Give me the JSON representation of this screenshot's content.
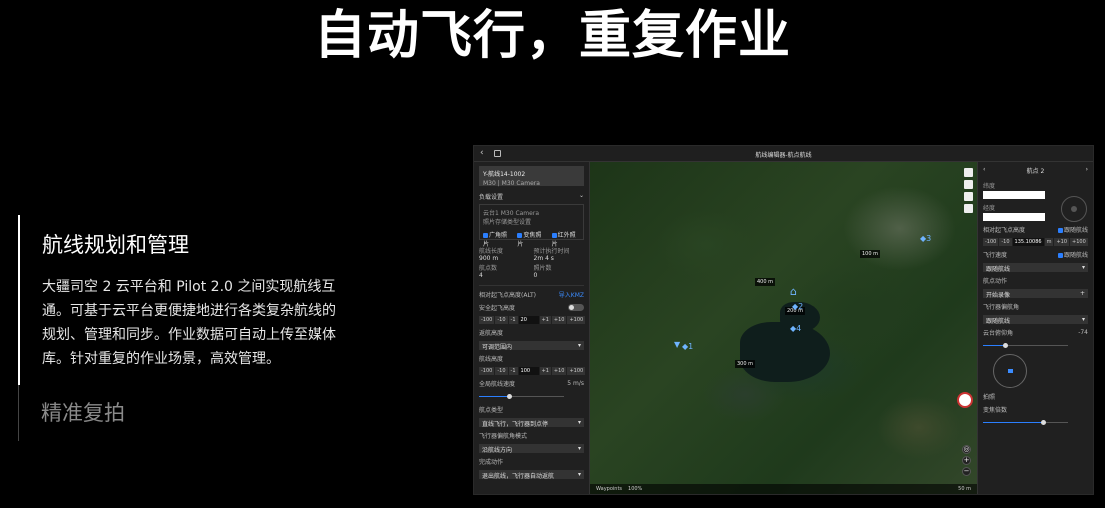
{
  "hero": {
    "title": "自动飞行，重复作业"
  },
  "features": [
    {
      "title": "航线规划和管理",
      "desc": "大疆司空 2 云平台和 Pilot 2.0 之间实现航线互通。可基于云平台更便捷地进行各类复杂航线的规划、管理和同步。作业数据可自动上传至媒体库。针对重复的作业场景，高效管理。"
    },
    {
      "title": "精准复拍"
    }
  ],
  "app": {
    "window_title": "航线编辑器-航点航线",
    "left_panel": {
      "route_name": "Y-航线14-1002",
      "route_sub": "M30  |  M30 Camera",
      "payload_section": "负载设置",
      "camera_name": "云台1  M30 Camera",
      "camera_hint": "照片存储类型设置",
      "photo_options": [
        "广角照片",
        "变焦照片",
        "红外照片"
      ],
      "stats": [
        {
          "label": "航线长度",
          "value": "900 m"
        },
        {
          "label": "预计执行时间",
          "value": "2m 4 s"
        },
        {
          "label": "航点数",
          "value": "4"
        },
        {
          "label": "照片数",
          "value": "0"
        }
      ],
      "altitude_mode": "相对起飞点高度(ALT)",
      "import_link": "导入KMZ",
      "safe_takeoff_label": "安全起飞高度",
      "safe_takeoff_value": "20",
      "return_alt_label": "返航高度",
      "return_alt_select": "可调范围内",
      "route_height_label": "航线高度",
      "route_height_value": "100",
      "speed_label": "全局航线速度",
      "speed_value": "5",
      "speed_unit": "m/s",
      "turn_mode_label": "航点类型",
      "turn_mode_value": "直线飞行，飞行器到点停",
      "heading_label": "飞行器偏航角模式",
      "heading_value": "沿航线方向",
      "gimbal_label": "云台控制模式",
      "gimbal_value": "手动控制",
      "finish_label": "完成动作",
      "finish_value": "退出航线，飞行器自动返航"
    },
    "map": {
      "labels": [
        "100 m",
        "200 m",
        "300 m",
        "400 m"
      ],
      "waypoint_labels": [
        "3",
        "2",
        "1",
        "4"
      ],
      "bottom_items": [
        "Waypoints",
        "100%"
      ],
      "scale": "50 m"
    },
    "right_panel": {
      "header": "航点 2",
      "lat_label": "纬度",
      "lon_label": "经度",
      "alt_label": "相对起飞点高度",
      "follow_route": "跟随航线",
      "alt_value": "135.10086",
      "alt_unit": "m",
      "speed_label": "飞行速度",
      "speed_value": "跟随航线",
      "action_label": "航点动作",
      "action_value": "开始录像",
      "heading_label": "飞行器偏航角",
      "heading_value": "跟随航线",
      "gimbal_pitch_label": "云台俯仰角",
      "gimbal_pitch_value": "-74",
      "photo_label": "拍照",
      "zoom_label": "变焦倍数",
      "turn_label": "航点类型",
      "turn_value": "直线飞行，飞行器到点停"
    }
  }
}
